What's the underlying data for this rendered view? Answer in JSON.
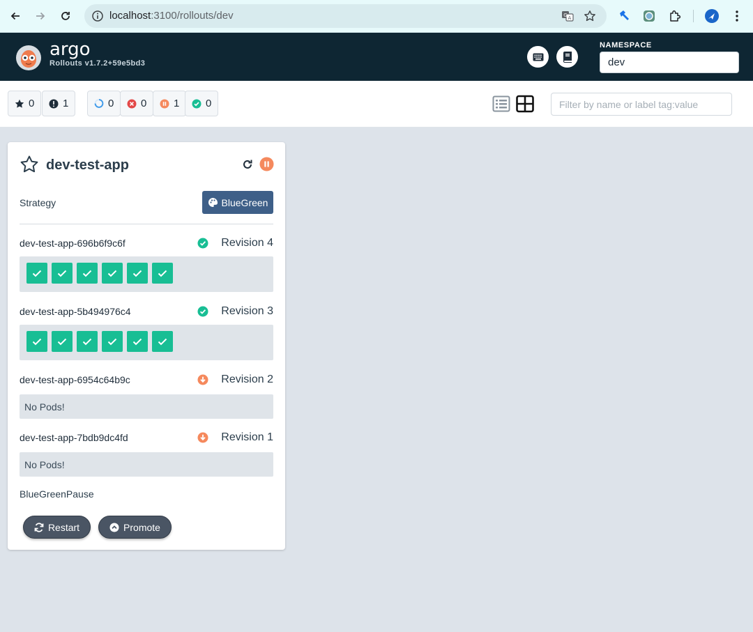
{
  "browser": {
    "url_host": "localhost",
    "url_path": ":3100/rollouts/dev"
  },
  "header": {
    "brand": "argo",
    "version": "Rollouts v1.7.2+59e5bd3",
    "namespace_label": "NAMESPACE",
    "namespace_value": "dev"
  },
  "toolbar": {
    "favorites_count": "0",
    "warnings_count": "1",
    "progressing_count": "0",
    "degraded_count": "0",
    "paused_count": "1",
    "healthy_count": "0",
    "filter_placeholder": "Filter by name or label tag:value"
  },
  "rollout": {
    "name": "dev-test-app",
    "strategy_label": "Strategy",
    "strategy": "BlueGreen",
    "status": "paused",
    "revisions": [
      {
        "name": "dev-test-app-696b6f9c6f",
        "label": "Revision 4",
        "status": "healthy",
        "pods": 6,
        "empty_text": ""
      },
      {
        "name": "dev-test-app-5b494976c4",
        "label": "Revision 3",
        "status": "healthy",
        "pods": 6,
        "empty_text": ""
      },
      {
        "name": "dev-test-app-6954c64b9c",
        "label": "Revision 2",
        "status": "scaled-down",
        "pods": 0,
        "empty_text": "No Pods!"
      },
      {
        "name": "dev-test-app-7bdb9dc4fd",
        "label": "Revision 1",
        "status": "scaled-down",
        "pods": 0,
        "empty_text": "No Pods!"
      }
    ],
    "current_step": "BlueGreenPause",
    "restart_label": "Restart",
    "promote_label": "Promote"
  },
  "colors": {
    "header_bg": "#0e2633",
    "healthy": "#18be94",
    "paused": "#f5895d",
    "degraded": "#e34848",
    "progressing": "#3f9ae9",
    "strategy_badge": "#3e5f88"
  }
}
